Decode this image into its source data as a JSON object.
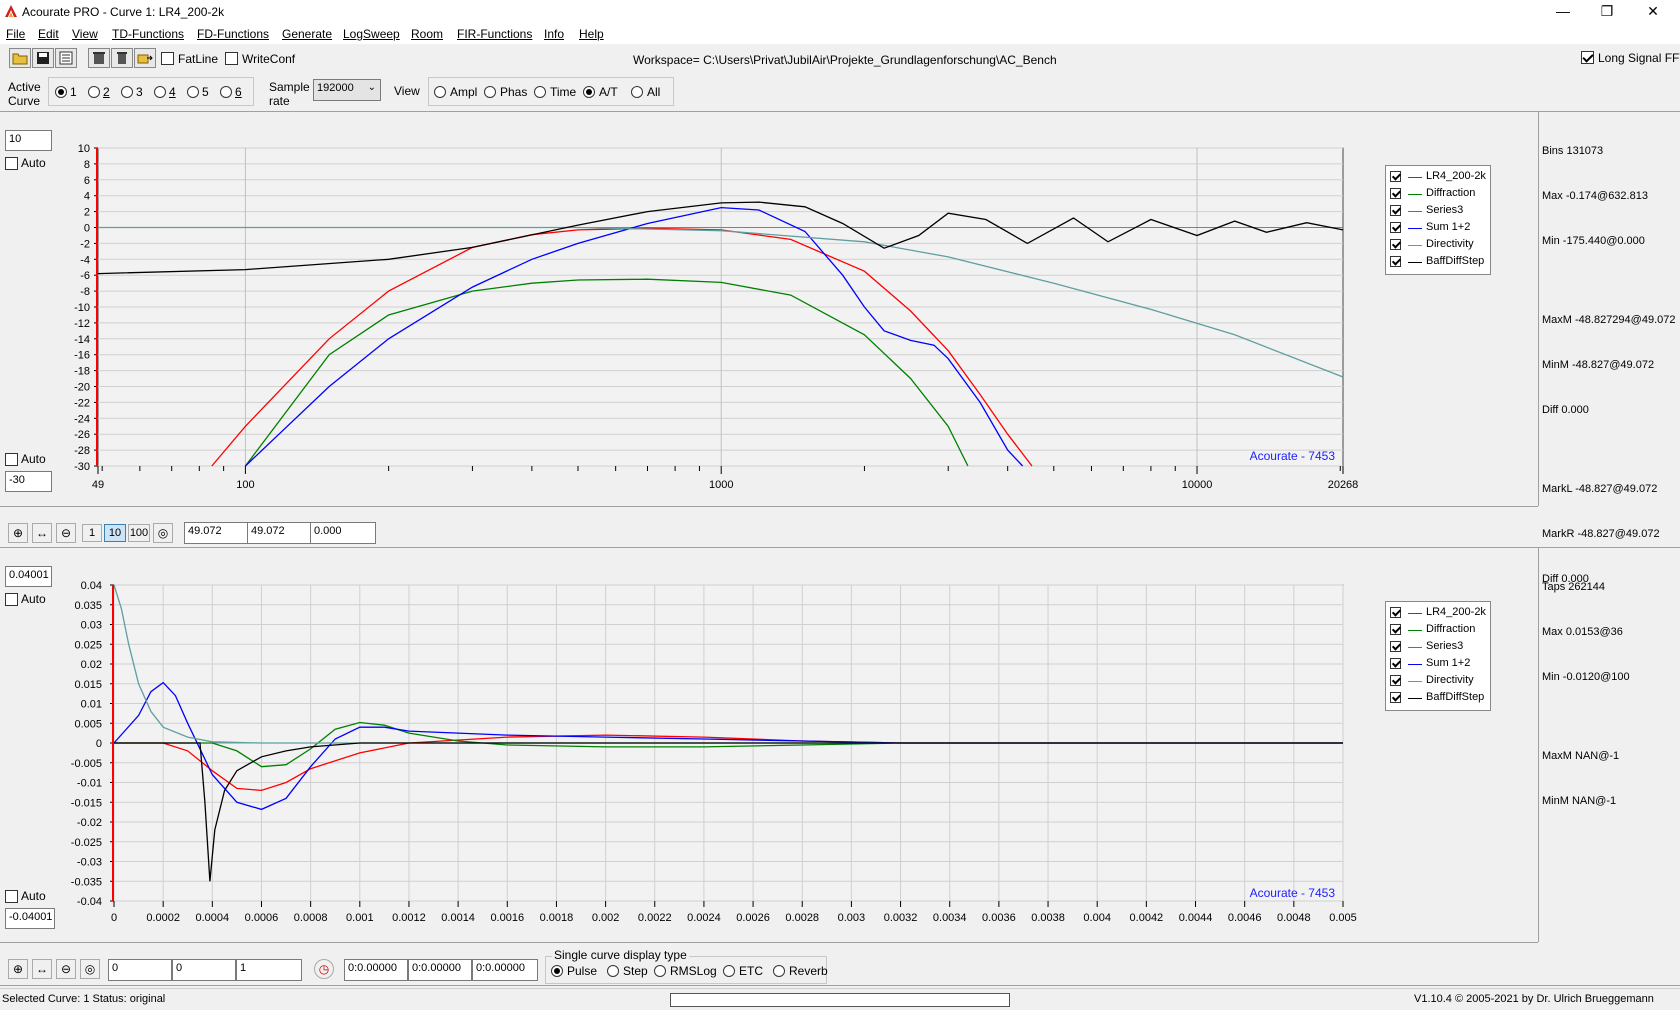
{
  "window": {
    "title": "Acourate PRO - Curve 1: LR4_200-2k",
    "minimize": "—",
    "restore": "❐",
    "close": "✕"
  },
  "menu": [
    "File",
    "Edit",
    "View",
    "TD-Functions",
    "FD-Functions",
    "Generate",
    "LogSweep",
    "Room",
    "FIR-Functions",
    "Info",
    "Help"
  ],
  "toolbar": {
    "fatline_label": "FatLine",
    "writeconf_label": "WriteConf",
    "workspace": "Workspace= C:\\Users\\Privat\\JubilAir\\Projekte_Grundlagenforschung\\AC_Bench",
    "long_signal_fft_label": "Long Signal FFT",
    "long_signal_fft_checked": true
  },
  "controls": {
    "active_curve_label_1": "Active",
    "active_curve_label_2": "Curve",
    "curves": [
      "1",
      "2",
      "3",
      "4",
      "5",
      "6"
    ],
    "active_curve": "1",
    "sample_rate_label_1": "Sample",
    "sample_rate_label_2": "rate",
    "sample_rate": "192000",
    "view_label": "View",
    "view_options": [
      "Ampl",
      "Phas",
      "Time",
      "A/T",
      "All"
    ],
    "view_selected": "A/T"
  },
  "top_panel": {
    "y_max_input": "10",
    "y_min_input": "-30",
    "auto_label": "Auto",
    "watermark": "Acourate - 7453",
    "info": {
      "bins": "Bins 131073",
      "max": "Max -0.174@632.813",
      "min": "Min -175.440@0.000",
      "maxm": "MaxM -48.827294@49.072",
      "minm": "MinM -48.827@49.072",
      "diff1": "Diff 0.000",
      "markl": "MarkL -48.827@49.072",
      "markr": "MarkR -48.827@49.072",
      "diff2": "Diff 0.000"
    },
    "zoom_buttons": [
      "1",
      "10",
      "100"
    ],
    "fields": [
      "49.072",
      "49.072",
      "0.000"
    ]
  },
  "bottom_panel": {
    "y_max_input": "0.04001",
    "y_min_input": "-0.04001",
    "auto_label": "Auto",
    "watermark": "Acourate - 7453",
    "info": {
      "taps": "Taps 262144",
      "max": "Max 0.0153@36",
      "min": "Min -0.0120@100",
      "maxm": "MaxM NAN@-1",
      "minm": "MinM NAN@-1"
    },
    "fields": [
      "0",
      "0",
      "1"
    ],
    "time_fields": [
      "0:0.00000",
      "0:0.00000",
      "0:0.00000"
    ],
    "display_type_label": "Single curve display type",
    "display_types": [
      "Pulse",
      "Step",
      "RMSLog",
      "ETC",
      "Reverb"
    ],
    "display_type_selected": "Pulse"
  },
  "legend": [
    {
      "name": "LR4_200-2k",
      "color": "#ff0000"
    },
    {
      "name": "Diffraction",
      "color": "#008000"
    },
    {
      "name": "Series3",
      "color": "#b05a1e"
    },
    {
      "name": "Sum 1+2",
      "color": "#0000ff"
    },
    {
      "name": "Directivity",
      "color": "#5f9ea0"
    },
    {
      "name": "BaffDiffStep",
      "color": "#000000"
    }
  ],
  "chart_data": [
    {
      "type": "line",
      "xscale": "log",
      "xlim": [
        49,
        20268
      ],
      "ylim": [
        -30,
        10
      ],
      "xtick_labels": [
        "49",
        "100",
        "1000",
        "10000",
        "20268"
      ],
      "ytick_labels": [
        "10",
        "8",
        "6",
        "4",
        "2",
        "0",
        "-2",
        "-4",
        "-6",
        "-8",
        "-10",
        "-12",
        "-14",
        "-16",
        "-18",
        "-20",
        "-22",
        "-24",
        "-26",
        "-28",
        "-30"
      ],
      "series": [
        {
          "name": "LR4_200-2k",
          "x": [
            85,
            100,
            150,
            200,
            300,
            400,
            500,
            700,
            1000,
            1400,
            2000,
            2500,
            3000,
            3500,
            4000,
            4500
          ],
          "y": [
            -30,
            -25,
            -14,
            -8,
            -2.5,
            -0.9,
            -0.3,
            -0.1,
            -0.3,
            -1.5,
            -5.5,
            -10.5,
            -15.5,
            -21,
            -26,
            -30
          ]
        },
        {
          "name": "Diffraction",
          "x": [
            100,
            150,
            200,
            300,
            400,
            500,
            700,
            1000,
            1400,
            2000,
            2500,
            3000,
            3300
          ],
          "y": [
            -30,
            -16,
            -11,
            -8,
            -7,
            -6.6,
            -6.5,
            -6.9,
            -8.5,
            -13.5,
            -19,
            -25,
            -30
          ]
        },
        {
          "name": "Sum 1+2",
          "x": [
            100,
            150,
            200,
            300,
            400,
            500,
            700,
            1000,
            1200,
            1500,
            1800,
            2000,
            2200,
            2500,
            2800,
            3000,
            3500,
            4000,
            4300
          ],
          "y": [
            -30,
            -20,
            -14,
            -7.5,
            -4,
            -2,
            0.5,
            2.5,
            2.2,
            -0.5,
            -6,
            -10,
            -13,
            -14.2,
            -14.8,
            -16.5,
            -22,
            -28,
            -30
          ]
        },
        {
          "name": "Directivity",
          "x": [
            49,
            200,
            500,
            1000,
            2000,
            3000,
            5000,
            8000,
            12000,
            20268
          ],
          "y": [
            0,
            0,
            0,
            -0.4,
            -1.8,
            -3.7,
            -7,
            -10.3,
            -13.5,
            -18.8
          ]
        },
        {
          "name": "BaffDiffStep",
          "x": [
            49,
            100,
            200,
            300,
            500,
            700,
            1000,
            1200,
            1500,
            1800,
            2200,
            2600,
            3000,
            3600,
            4400,
            5500,
            6500,
            8000,
            10000,
            12000,
            14000,
            17000,
            20268
          ],
          "y": [
            -5.8,
            -5.3,
            -4,
            -2.5,
            0.3,
            2,
            3.1,
            3.2,
            2.6,
            0.5,
            -2.6,
            -1,
            1.8,
            1,
            -2,
            1.2,
            -1.8,
            1,
            -1,
            0.8,
            -0.6,
            0.6,
            -0.3
          ]
        }
      ]
    },
    {
      "type": "line",
      "xlim": [
        0,
        0.005
      ],
      "ylim": [
        -0.04,
        0.04
      ],
      "xtick_labels": [
        "0",
        "0.0002",
        "0.0004",
        "0.0006",
        "0.0008",
        "0.001",
        "0.0012",
        "0.0014",
        "0.0016",
        "0.0018",
        "0.002",
        "0.0022",
        "0.0024",
        "0.0026",
        "0.0028",
        "0.003",
        "0.0032",
        "0.0034",
        "0.0036",
        "0.0038",
        "0.004",
        "0.0042",
        "0.0044",
        "0.0046",
        "0.0048",
        "0.005"
      ],
      "ytick_labels": [
        "0.04",
        "0.035",
        "0.03",
        "0.025",
        "0.02",
        "0.015",
        "0.01",
        "0.005",
        "0",
        "-0.005",
        "-0.01",
        "-0.015",
        "-0.02",
        "-0.025",
        "-0.03",
        "-0.035",
        "-0.04"
      ],
      "series": [
        {
          "name": "LR4_200-2k",
          "x": [
            0,
            0.0002,
            0.0003,
            0.0004,
            0.0005,
            0.0006,
            0.0007,
            0.0008,
            0.001,
            0.0012,
            0.0016,
            0.002,
            0.0024,
            0.0028,
            0.0032,
            0.005
          ],
          "y": [
            0,
            0,
            -0.002,
            -0.007,
            -0.0115,
            -0.012,
            -0.01,
            -0.0065,
            -0.0025,
            0,
            0.0015,
            0.002,
            0.0015,
            0.0005,
            0,
            0
          ]
        },
        {
          "name": "Diffraction",
          "x": [
            0,
            0.0003,
            0.0004,
            0.0005,
            0.0006,
            0.0007,
            0.0008,
            0.0009,
            0.001,
            0.0011,
            0.0012,
            0.0014,
            0.0016,
            0.002,
            0.0024,
            0.0028,
            0.0032,
            0.005
          ],
          "y": [
            0,
            0,
            0,
            -0.002,
            -0.006,
            -0.0055,
            -0.0015,
            0.0035,
            0.0052,
            0.0045,
            0.0025,
            0.0005,
            -0.0005,
            -0.001,
            -0.001,
            -0.0005,
            0,
            0
          ]
        },
        {
          "name": "Sum 1+2",
          "x": [
            0,
            0.0001,
            0.00015,
            0.0002,
            0.00025,
            0.0003,
            0.0004,
            0.0005,
            0.0006,
            0.0007,
            0.0008,
            0.0009,
            0.001,
            0.0011,
            0.0012,
            0.0016,
            0.002,
            0.0024,
            0.0028,
            0.0032,
            0.005
          ],
          "y": [
            0,
            0.007,
            0.013,
            0.0153,
            0.012,
            0.005,
            -0.008,
            -0.015,
            -0.0168,
            -0.014,
            -0.006,
            0.001,
            0.004,
            0.004,
            0.003,
            0.002,
            0.0015,
            0.001,
            0.0005,
            0,
            0
          ]
        },
        {
          "name": "Directivity",
          "x": [
            0,
            3e-05,
            6e-05,
            0.0001,
            0.00015,
            0.0002,
            0.0003,
            0.0004,
            0.0006,
            0.005
          ],
          "y": [
            0.04,
            0.034,
            0.025,
            0.015,
            0.008,
            0.004,
            0.0015,
            0.0003,
            0,
            0
          ]
        },
        {
          "name": "BaffDiffStep",
          "x": [
            0,
            0.00035,
            0.00037,
            0.00039,
            0.00041,
            0.00045,
            0.0005,
            0.0006,
            0.0007,
            0.0008,
            0.001,
            0.002,
            0.005
          ],
          "y": [
            0,
            0,
            -0.015,
            -0.035,
            -0.022,
            -0.012,
            -0.007,
            -0.0035,
            -0.002,
            -0.001,
            0,
            0,
            0
          ]
        }
      ]
    }
  ],
  "statusbar": {
    "left": "Selected Curve: 1   Status: original",
    "right": "V1.10.4 © 2005-2021 by Dr. Ulrich Brueggemann"
  }
}
